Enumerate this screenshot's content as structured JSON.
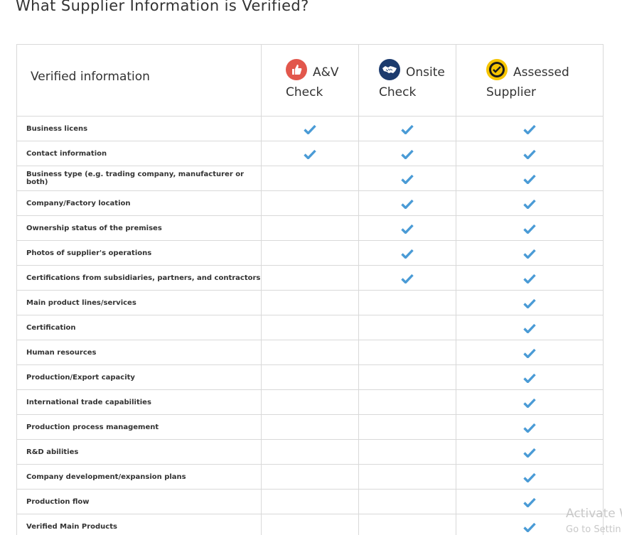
{
  "page": {
    "title": "What Supplier Information is Verified?"
  },
  "table": {
    "header_label": "Verified information",
    "plans": [
      {
        "name_line1": "A&V",
        "name_line2": "Check",
        "icon": "thumbs-up-icon",
        "color": "#e2574c"
      },
      {
        "name_line1": "Onsite",
        "name_line2": "Check",
        "icon": "handshake-icon",
        "color": "#1c3b6e"
      },
      {
        "name_line1": "Assessed",
        "name_line2": "Supplier",
        "icon": "assessed-badge-icon",
        "color": "#f5c400"
      }
    ],
    "check_color": "#4a9bd6",
    "rows": [
      {
        "label": "Business licens",
        "checks": [
          true,
          true,
          true
        ]
      },
      {
        "label": "Contact information",
        "checks": [
          true,
          true,
          true
        ]
      },
      {
        "label": "Business type (e.g. trading company, manufacturer or both)",
        "checks": [
          false,
          true,
          true
        ]
      },
      {
        "label": "Company/Factory location",
        "checks": [
          false,
          true,
          true
        ]
      },
      {
        "label": "Ownership status of the premises",
        "checks": [
          false,
          true,
          true
        ]
      },
      {
        "label": "Photos of supplier's operations",
        "checks": [
          false,
          true,
          true
        ]
      },
      {
        "label": "Certifications from subsidiaries, partners, and contractors",
        "checks": [
          false,
          true,
          true
        ]
      },
      {
        "label": "Main product lines/services",
        "checks": [
          false,
          false,
          true
        ]
      },
      {
        "label": "Certification",
        "checks": [
          false,
          false,
          true
        ]
      },
      {
        "label": "Human resources",
        "checks": [
          false,
          false,
          true
        ]
      },
      {
        "label": "Production/Export capacity",
        "checks": [
          false,
          false,
          true
        ]
      },
      {
        "label": "International trade capabilities",
        "checks": [
          false,
          false,
          true
        ]
      },
      {
        "label": "Production process management",
        "checks": [
          false,
          false,
          true
        ]
      },
      {
        "label": "R&D abilities",
        "checks": [
          false,
          false,
          true
        ]
      },
      {
        "label": "Company development/expansion plans",
        "checks": [
          false,
          false,
          true
        ]
      },
      {
        "label": "Production flow",
        "checks": [
          false,
          false,
          true
        ]
      },
      {
        "label": "Verified Main Products",
        "checks": [
          false,
          false,
          true
        ]
      }
    ]
  },
  "watermark": {
    "line1": "Activate W",
    "line2": "Go to Settin"
  }
}
